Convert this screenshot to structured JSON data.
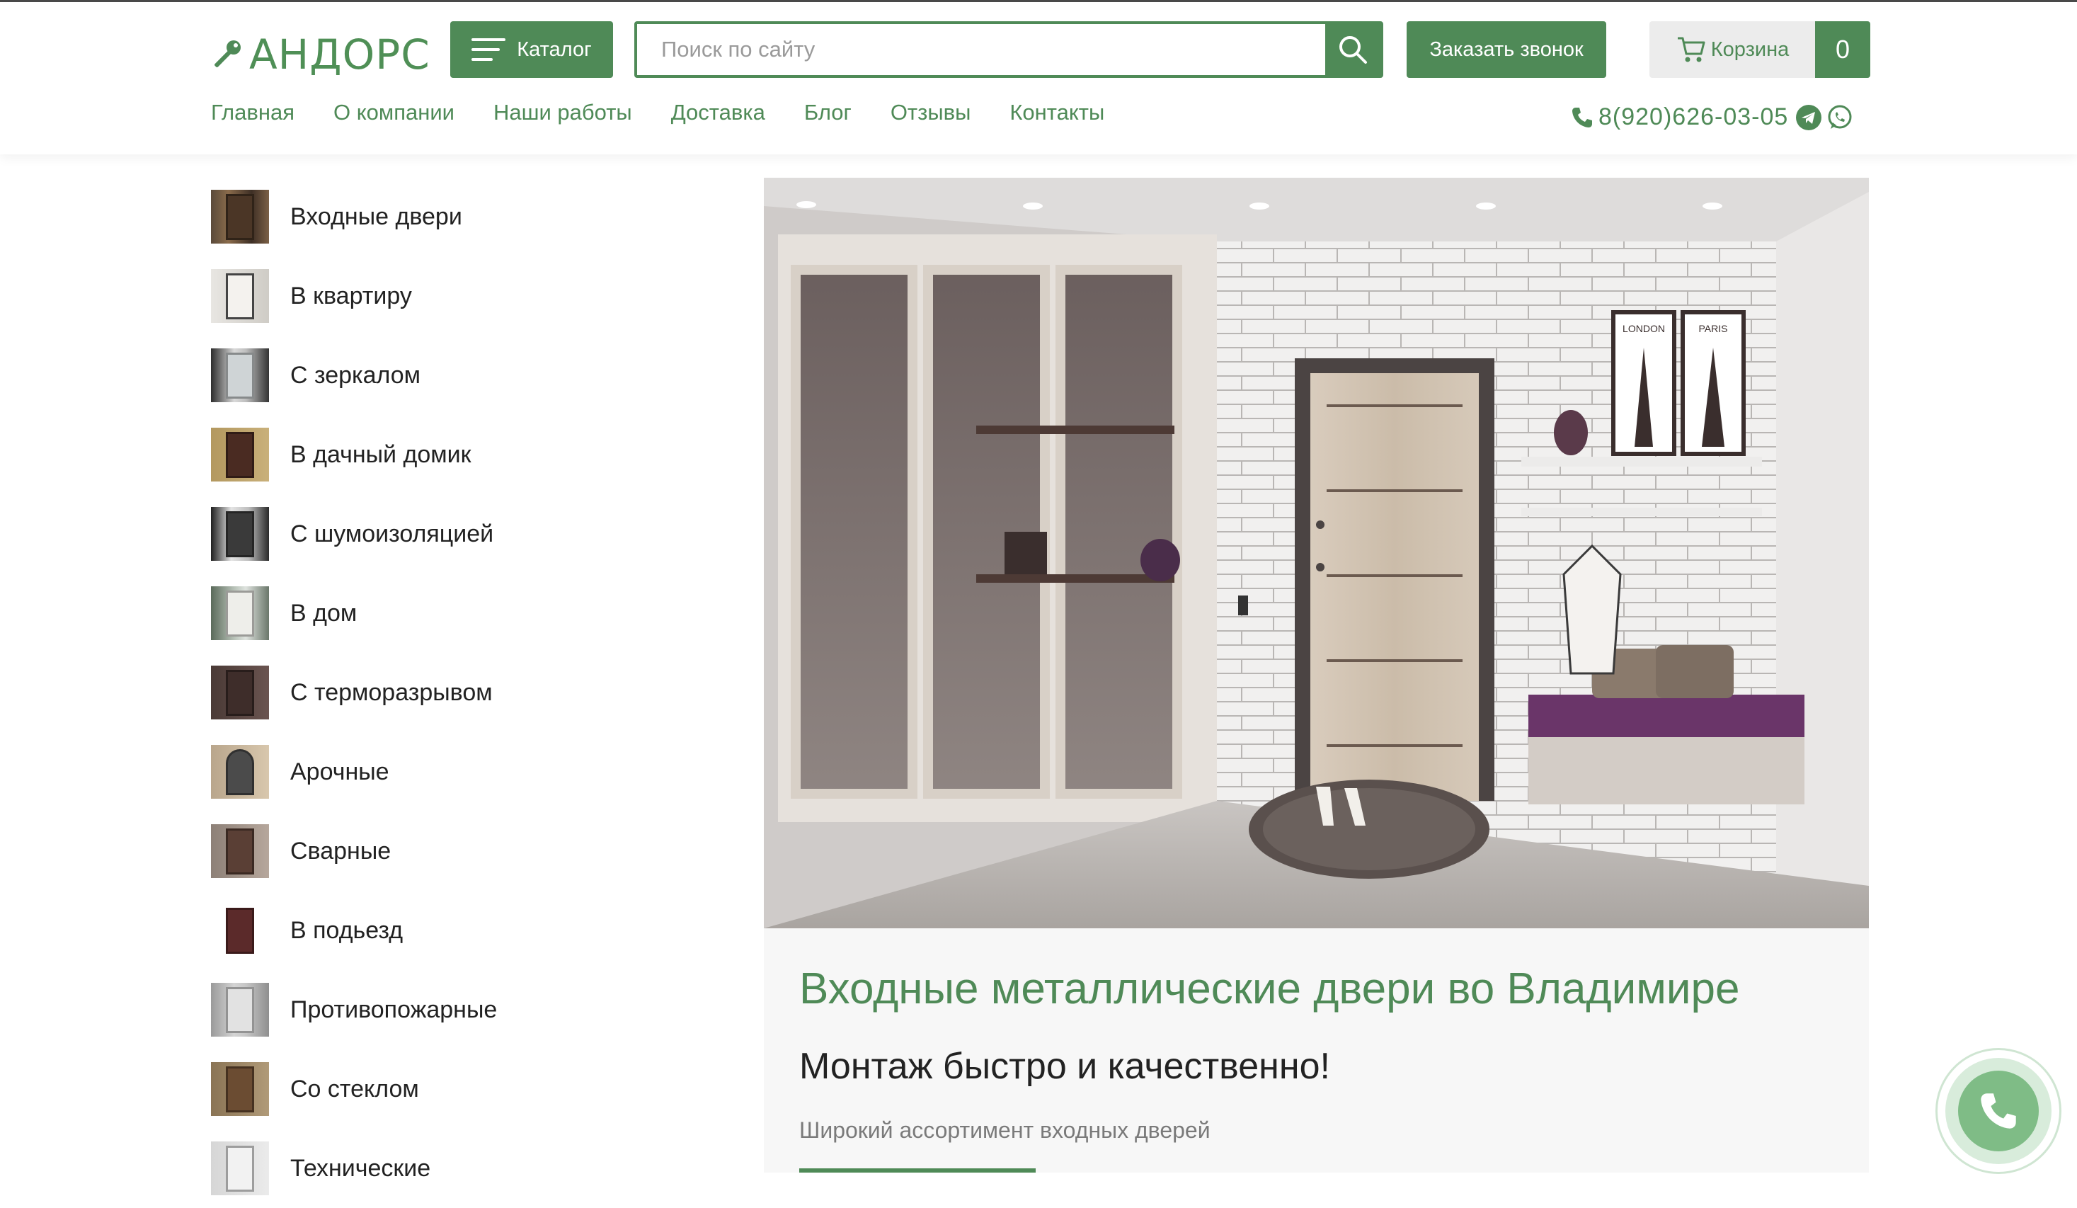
{
  "header": {
    "logo_text": "АНДОРС",
    "catalog_label": "Каталог",
    "search_placeholder": "Поиск по сайту",
    "callback_label": "Заказать звонок",
    "cart_label": "Корзина",
    "cart_count": "0",
    "phone": "8(920)626-03-05"
  },
  "nav": [
    {
      "label": "Главная"
    },
    {
      "label": "О компании"
    },
    {
      "label": "Наши работы"
    },
    {
      "label": "Доставка"
    },
    {
      "label": "Блог"
    },
    {
      "label": "Отзывы"
    },
    {
      "label": "Контакты"
    }
  ],
  "categories": [
    {
      "label": "Входные двери"
    },
    {
      "label": "В квартиру"
    },
    {
      "label": "С зеркалом"
    },
    {
      "label": "В дачный домик"
    },
    {
      "label": "С шумоизоляцией"
    },
    {
      "label": "В дом"
    },
    {
      "label": "С терморазрывом"
    },
    {
      "label": "Арочные"
    },
    {
      "label": "Сварные"
    },
    {
      "label": "В подьезд"
    },
    {
      "label": "Противопожарные"
    },
    {
      "label": "Со стеклом"
    },
    {
      "label": "Технические"
    }
  ],
  "hero": {
    "title": "Входные металлические двери во Владимире",
    "subtitle": "Монтаж быстро и качественно!",
    "description": "Широкий ассортимент входных дверей",
    "poster_1_text": "LONDON",
    "poster_2_text": "PARIS"
  },
  "colors": {
    "brand_green": "#4f8a57",
    "float_button_green": "#7fbc86"
  }
}
